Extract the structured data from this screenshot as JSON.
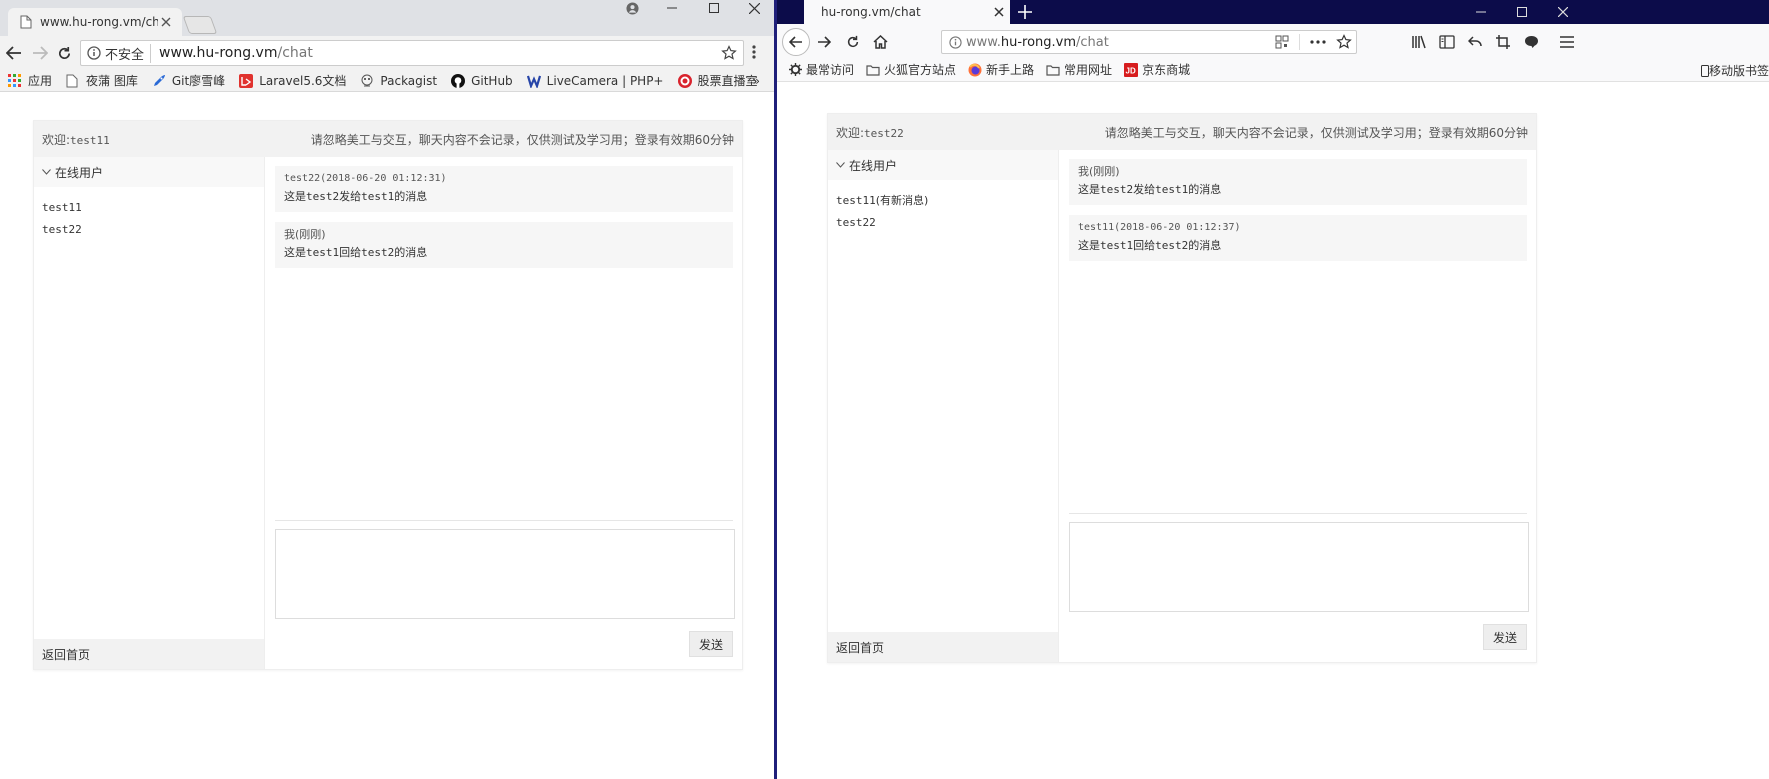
{
  "left": {
    "tab": {
      "title": "www.hu-rong.vm/chat"
    },
    "omnibox": {
      "insecure_label": "不安全",
      "url_host": "www.hu-rong.vm",
      "url_path": "/chat"
    },
    "bookmarks": [
      {
        "label": "应用",
        "icon": "apps-grid-icon"
      },
      {
        "label": "夜蒲 图库",
        "icon": "page-icon"
      },
      {
        "label": "Git廖雪峰",
        "icon": "rocket-icon"
      },
      {
        "label": "Laravel5.6文档",
        "icon": "laravel-icon"
      },
      {
        "label": "Packagist",
        "icon": "packagist-icon"
      },
      {
        "label": "GitHub",
        "icon": "github-icon"
      },
      {
        "label": "LiveCamera | PHP+",
        "icon": "livecamera-icon"
      },
      {
        "label": "股票直播室",
        "icon": "target-icon"
      }
    ],
    "bookmarks_more": "»",
    "chat": {
      "welcome_prefix": "欢迎:",
      "welcome_user": "test11",
      "notice": "请忽略美工与交互，聊天内容不会记录，仅供测试及学习用；登录有效期60分钟",
      "online_users_title": "在线用户",
      "users": [
        {
          "name": "test11",
          "note": ""
        },
        {
          "name": "test22",
          "note": ""
        }
      ],
      "messages": [
        {
          "meta": "test22(2018-06-20 01:12:31)",
          "text_pre": "这是",
          "text_a": "test2",
          "text_mid": "发给",
          "text_b": "test1",
          "text_post": "的消息"
        },
        {
          "meta": "我(刚刚)",
          "text_pre": "这是",
          "text_a": "test1",
          "text_mid": "回给",
          "text_b": "test2",
          "text_post": "的消息"
        }
      ],
      "back_home": "返回首页",
      "send": "发送"
    }
  },
  "right": {
    "tab": {
      "title": "hu-rong.vm/chat"
    },
    "urlbar": {
      "scheme": "www.",
      "url_host": "hu-rong.vm",
      "url_path": "/chat"
    },
    "bookmarks": [
      {
        "label": "最常访问",
        "icon": "gear-icon"
      },
      {
        "label": "火狐官方站点",
        "icon": "folder-icon"
      },
      {
        "label": "新手上路",
        "icon": "firefox-icon"
      },
      {
        "label": "常用网址",
        "icon": "folder-icon"
      },
      {
        "label": "京东商城",
        "icon": "jd-icon"
      }
    ],
    "mobile_bookmarks": "移动版书签",
    "chat": {
      "welcome_prefix": "欢迎:",
      "welcome_user": "test22",
      "notice": "请忽略美工与交互，聊天内容不会记录，仅供测试及学习用；登录有效期60分钟",
      "online_users_title": "在线用户",
      "users": [
        {
          "name": "test11",
          "note": "(有新消息)"
        },
        {
          "name": "test22",
          "note": ""
        }
      ],
      "messages": [
        {
          "meta": "我(刚刚)",
          "text_pre": "这是",
          "text_a": "test2",
          "text_mid": "发给",
          "text_b": "test1",
          "text_post": "的消息"
        },
        {
          "meta": "test11(2018-06-20 01:12:37)",
          "text_pre": "这是",
          "text_a": "test1",
          "text_mid": "回给",
          "text_b": "test2",
          "text_post": "的消息"
        }
      ],
      "back_home": "返回首页",
      "send": "发送"
    }
  }
}
